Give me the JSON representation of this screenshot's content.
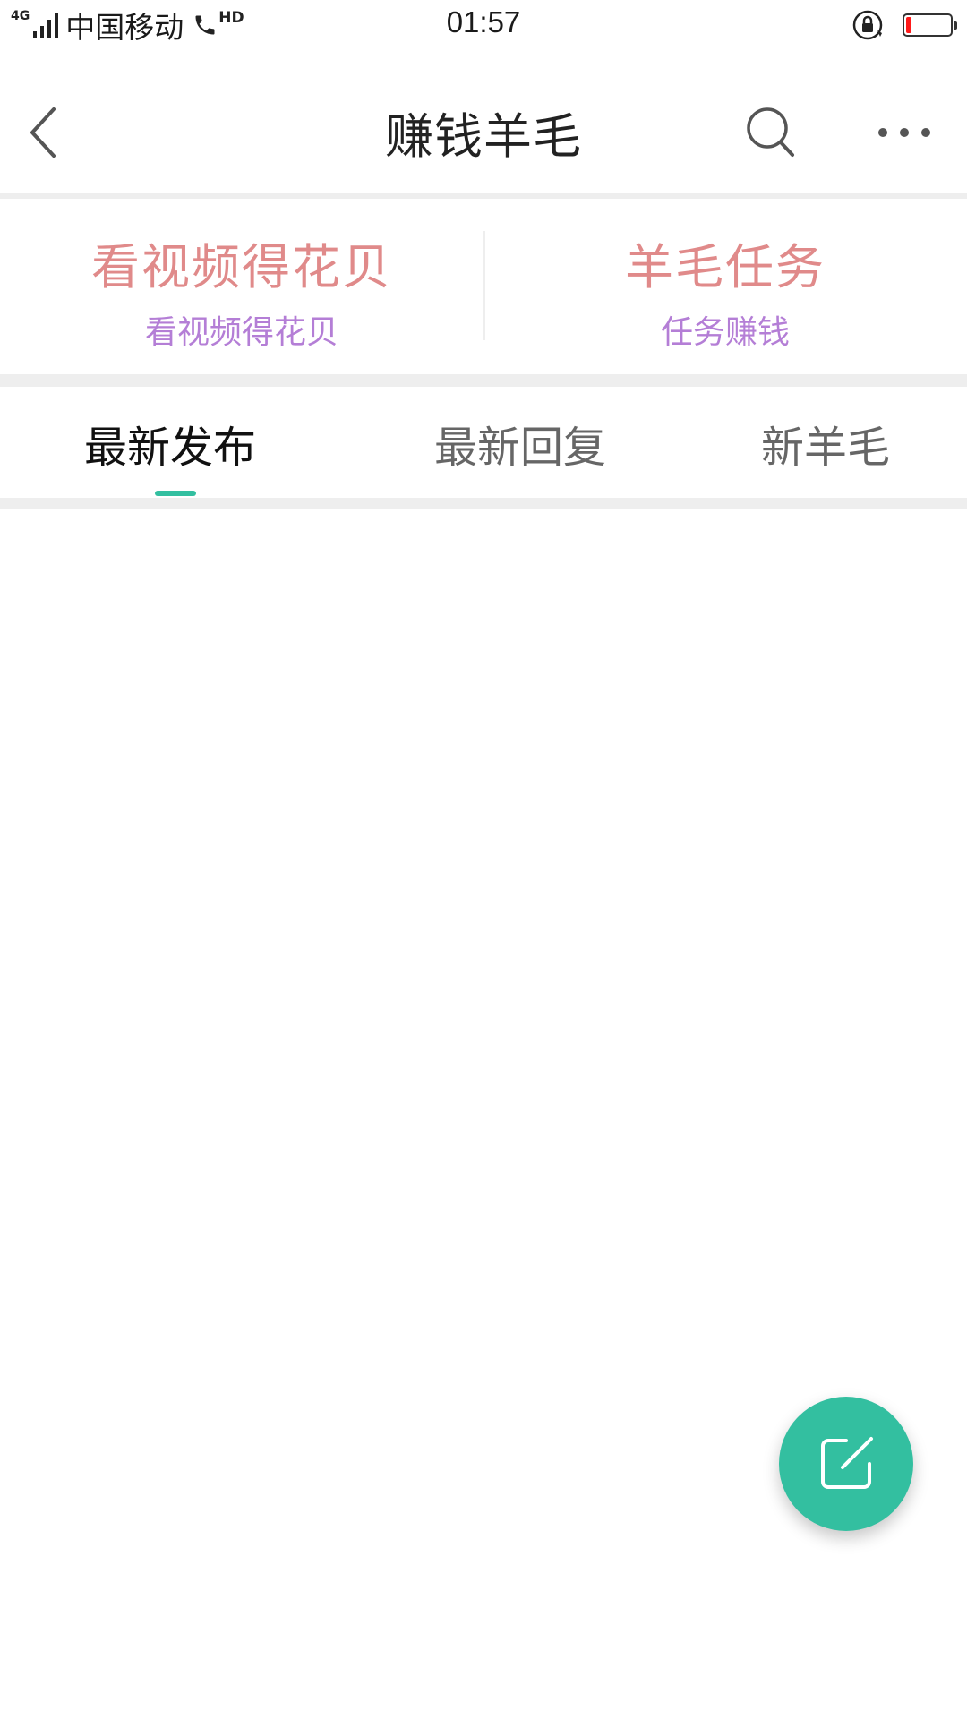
{
  "status_bar": {
    "network": "4G",
    "carrier": "中国移动",
    "hd": "HD",
    "time": "01:57",
    "battery_level": 0.12,
    "battery_color": "#ff1a1a"
  },
  "header": {
    "title": "赚钱羊毛",
    "back_icon": "back-chevron-icon",
    "search_icon": "search-icon",
    "more_icon": "more-dots-icon"
  },
  "features": [
    {
      "title": "看视频得花贝",
      "subtitle": "看视频得花贝"
    },
    {
      "title": "羊毛任务",
      "subtitle": "任务赚钱"
    }
  ],
  "tabs": [
    {
      "label": "最新发布",
      "active": true
    },
    {
      "label": "最新回复",
      "active": false
    },
    {
      "label": "新羊毛",
      "active": false
    }
  ],
  "colors": {
    "accent": "#33bfa0",
    "feature_title": "#e08a8a",
    "feature_subtitle": "#b47ed6"
  },
  "fab": {
    "icon": "compose-icon"
  }
}
